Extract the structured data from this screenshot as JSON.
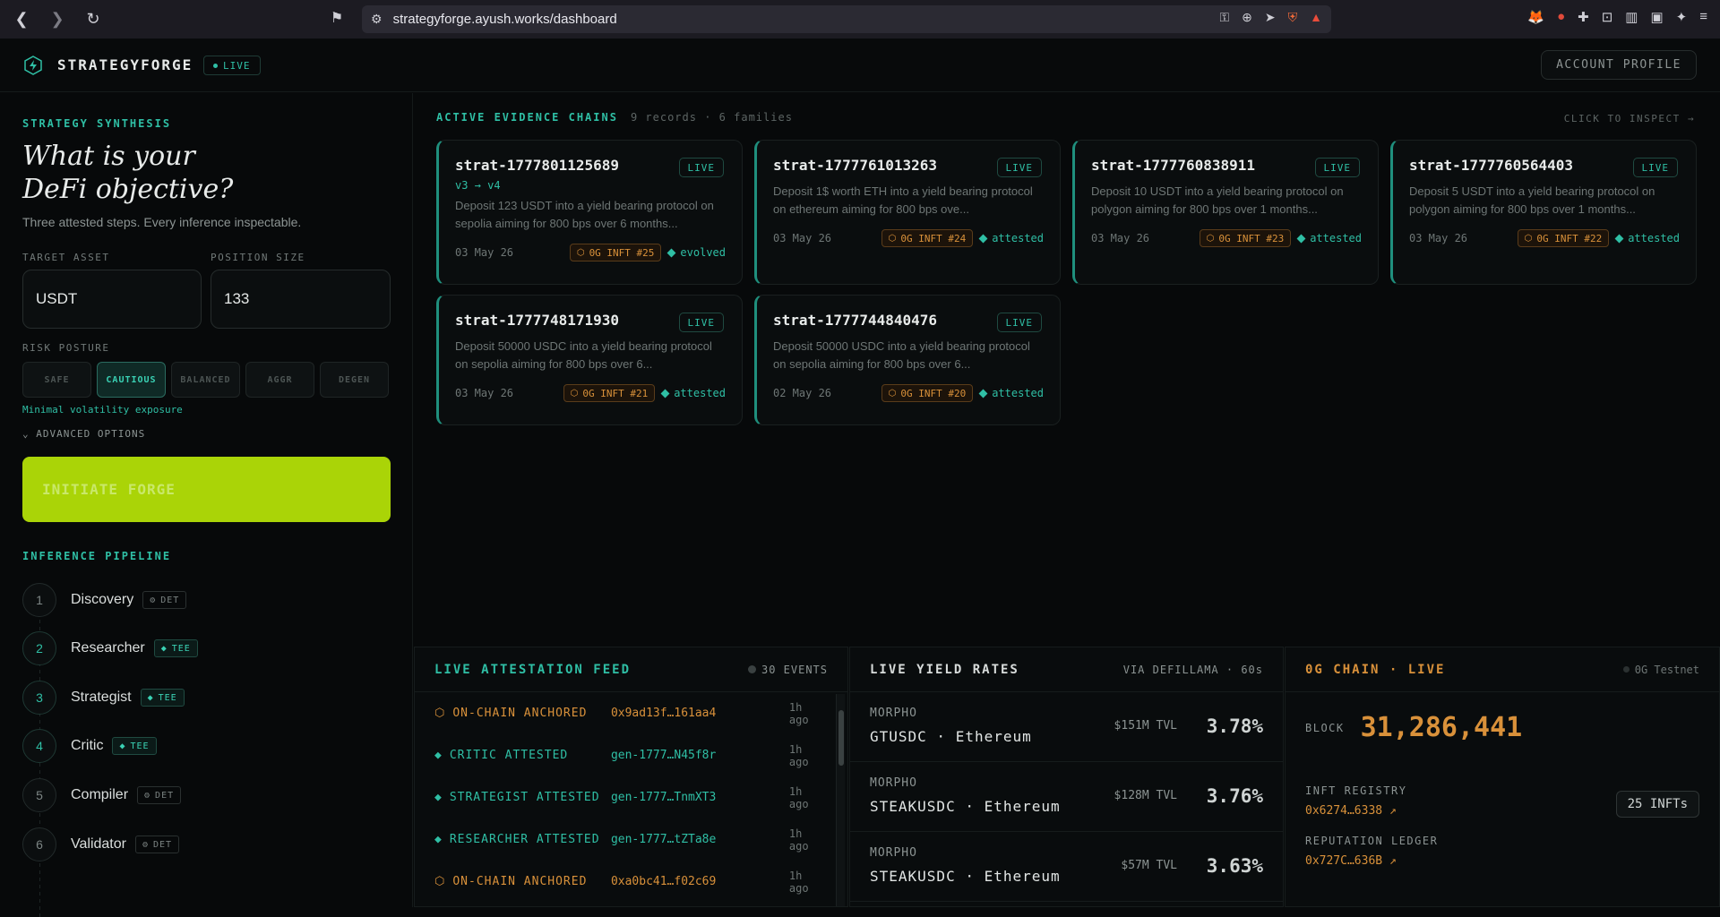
{
  "browser": {
    "url": "strategyforge.ayush.works/dashboard"
  },
  "header": {
    "brand": "STRATEGYFORGE",
    "status": "LIVE",
    "account_button": "ACCOUNT PROFILE"
  },
  "sidebar": {
    "section_label": "STRATEGY SYNTHESIS",
    "heading_line1": "What is your",
    "heading_line2": "DeFi objective?",
    "subheading": "Three attested steps. Every inference inspectable.",
    "target_asset_label": "TARGET ASSET",
    "target_asset_value": "USDT",
    "position_size_label": "POSITION SIZE",
    "position_size_value": "133",
    "risk_label": "RISK POSTURE",
    "risk_options": [
      "SAFE",
      "CAUTIOUS",
      "BALANCED",
      "AGGR",
      "DEGEN"
    ],
    "risk_selected": "CAUTIOUS",
    "risk_hint": "Minimal volatility exposure",
    "advanced_label": "ADVANCED OPTIONS",
    "forge_button": "INITIATE FORGE",
    "pipeline_label": "INFERENCE PIPELINE",
    "pipeline": [
      {
        "num": "1",
        "name": "Discovery",
        "badge": "DET"
      },
      {
        "num": "2",
        "name": "Researcher",
        "badge": "TEE"
      },
      {
        "num": "3",
        "name": "Strategist",
        "badge": "TEE"
      },
      {
        "num": "4",
        "name": "Critic",
        "badge": "TEE"
      },
      {
        "num": "5",
        "name": "Compiler",
        "badge": "DET"
      },
      {
        "num": "6",
        "name": "Validator",
        "badge": "DET"
      }
    ]
  },
  "chains": {
    "title": "ACTIVE EVIDENCE CHAINS",
    "records": "9 records",
    "families": "6 families",
    "inspect": "CLICK TO INSPECT →",
    "cards": [
      {
        "id": "strat-1777801125689",
        "version": "v3 → v4",
        "live": "LIVE",
        "desc": "Deposit 123 USDT into a yield bearing protocol on sepolia aiming for 800 bps over 6 months...",
        "date": "03 May 26",
        "inft": "0G INFT #25",
        "status": "evolved"
      },
      {
        "id": "strat-1777761013263",
        "version": "",
        "live": "LIVE",
        "desc": "Deposit 1$ worth ETH into a yield bearing protocol on ethereum aiming for 800 bps ove...",
        "date": "03 May 26",
        "inft": "0G INFT #24",
        "status": "attested"
      },
      {
        "id": "strat-1777760838911",
        "version": "",
        "live": "LIVE",
        "desc": "Deposit 10 USDT into a yield bearing protocol on polygon aiming for 800 bps over 1 months...",
        "date": "03 May 26",
        "inft": "0G INFT #23",
        "status": "attested"
      },
      {
        "id": "strat-1777760564403",
        "version": "",
        "live": "LIVE",
        "desc": "Deposit 5 USDT into a yield bearing protocol on polygon aiming for 800 bps over 1 months...",
        "date": "03 May 26",
        "inft": "0G INFT #22",
        "status": "attested"
      },
      {
        "id": "strat-1777748171930",
        "version": "",
        "live": "LIVE",
        "desc": "Deposit 50000 USDC into a yield bearing protocol on sepolia aiming for 800 bps over 6...",
        "date": "03 May 26",
        "inft": "0G INFT #21",
        "status": "attested"
      },
      {
        "id": "strat-1777744840476",
        "version": "",
        "live": "LIVE",
        "desc": "Deposit 50000 USDC into a yield bearing protocol on sepolia aiming for 800 bps over 6...",
        "date": "02 May 26",
        "inft": "0G INFT #20",
        "status": "attested"
      }
    ]
  },
  "feed": {
    "title": "LIVE ATTESTATION FEED",
    "events": "30 EVENTS",
    "rows": [
      {
        "kind": "ON-CHAIN ANCHORED",
        "hash": "0x9ad13f…161aa4",
        "ago": "1h ago",
        "type": "anchor"
      },
      {
        "kind": "CRITIC ATTESTED",
        "hash": "gen-1777…N45f8r",
        "ago": "1h ago",
        "type": "attest"
      },
      {
        "kind": "STRATEGIST ATTESTED",
        "hash": "gen-1777…TnmXT3",
        "ago": "1h ago",
        "type": "attest"
      },
      {
        "kind": "RESEARCHER ATTESTED",
        "hash": "gen-1777…tZTa8e",
        "ago": "1h ago",
        "type": "attest"
      },
      {
        "kind": "ON-CHAIN ANCHORED",
        "hash": "0xa0bc41…f02c69",
        "ago": "1h ago",
        "type": "anchor"
      }
    ]
  },
  "yields": {
    "title": "LIVE YIELD RATES",
    "source": "VIA DEFILLAMA · 60s",
    "rows": [
      {
        "protocol": "MORPHO",
        "pair": "GTUSDC · Ethereum",
        "tvl": "$151M TVL",
        "apy": "3.78%"
      },
      {
        "protocol": "MORPHO",
        "pair": "STEAKUSDC · Ethereum",
        "tvl": "$128M TVL",
        "apy": "3.76%"
      },
      {
        "protocol": "MORPHO",
        "pair": "STEAKUSDC · Ethereum",
        "tvl": "$57M TVL",
        "apy": "3.63%"
      }
    ]
  },
  "chain": {
    "title": "0G CHAIN · LIVE",
    "network": "0G Testnet",
    "block_label": "BLOCK",
    "block_value": "31,286,441",
    "registry_label": "INFT REGISTRY",
    "registry_addr": "0x6274…6338 ↗",
    "infts": "25 INFTs",
    "ledger_label": "REPUTATION LEDGER",
    "ledger_addr": "0x727C…636B ↗"
  }
}
